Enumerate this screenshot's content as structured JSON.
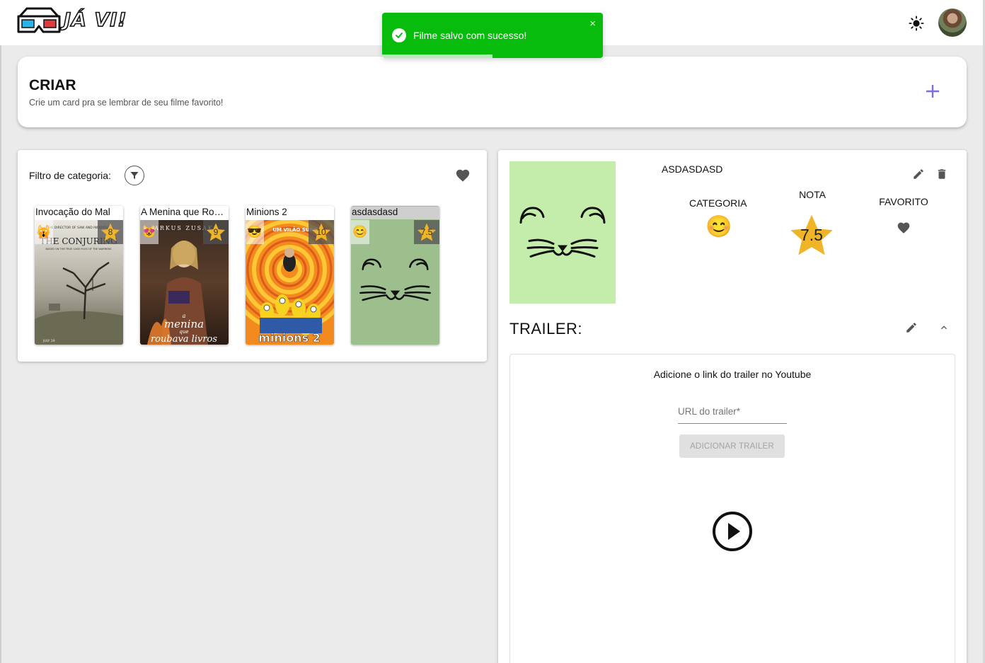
{
  "app": {
    "logo_text": "JÁ VI!"
  },
  "header": {
    "theme_icon": "sun-icon",
    "avatar_icon": "user-avatar"
  },
  "toast": {
    "message": "Filme salvo com sucesso!",
    "close": "×",
    "progress_fraction": 0.5,
    "color": "#07bc0c"
  },
  "create": {
    "title": "CRIAR",
    "subtitle": "Crie um card pra se lembrar de seu filme favorito!",
    "add_icon": "plus-icon",
    "accent": "#7e6fd8"
  },
  "filter": {
    "label": "Filtro de categoria:",
    "filter_icon": "filter-icon",
    "favorite_icon": "heart-icon"
  },
  "movies": [
    {
      "title": "Invocação do Mal",
      "emoji": "🙀",
      "score": "8"
    },
    {
      "title": "A Menina que Roubava Livros",
      "emoji": "😻",
      "score": "9"
    },
    {
      "title": "Minions 2",
      "emoji": "😎",
      "score": "10"
    },
    {
      "title": "asdasdasd",
      "emoji": "😊",
      "score": "7.5"
    }
  ],
  "poster_texts": {
    "conjuring_top": "THE DIRECTOR OF SAW AND INSIDIOUS",
    "conjuring_title": "THE CONJURING",
    "conjuring_tagline": "BASED ON THE TRUE CASE FILES OF THE WARRENS",
    "conjuring_date": "JULY 19",
    "menina_credit": "ARKUS ZUSAK",
    "menina_title_1": "a",
    "menina_title_2": "menina",
    "menina_title_3": "que",
    "menina_title_4": "roubava livros",
    "minions_banner": "UM VILÃO SURG",
    "minions_title": "minions 2"
  },
  "detail": {
    "name": "ASDASDASD",
    "category_label": "CATEGORIA",
    "score_label": "NOTA",
    "favorite_label": "FAVORITO",
    "category_emoji": "😊",
    "score": "7.5",
    "star_color": "#f0b429",
    "poster_bg": "#c4ecaa",
    "edit_icon": "pencil-icon",
    "delete_icon": "trash-icon"
  },
  "trailer": {
    "title": "TRAILER:",
    "hint": "Adicione o link do trailer no Youtube",
    "url_placeholder": "URL do trailer*",
    "add_button": "ADICIONAR TRAILER",
    "edit_icon": "pencil-icon",
    "collapse_icon": "chevron-up-icon",
    "play_icon": "play-circle-icon"
  }
}
